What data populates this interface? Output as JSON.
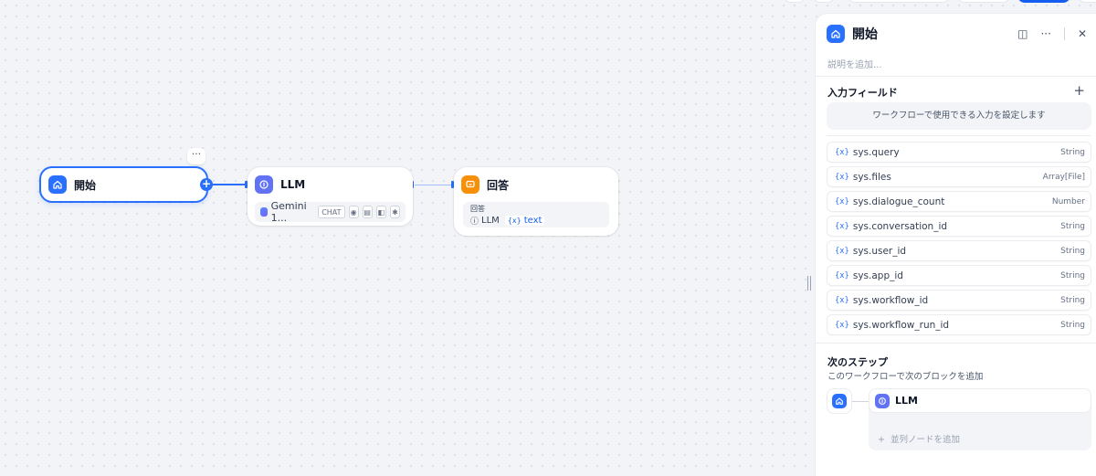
{
  "canvas": {
    "start_node": {
      "title": "開始",
      "more": "···"
    },
    "llm_node": {
      "title": "LLM",
      "model": "Gemini 1...",
      "mode_tag": "CHAT"
    },
    "answer_node": {
      "title": "回答",
      "label": "回答",
      "var_node": "LLM",
      "var_name": "text"
    }
  },
  "panel": {
    "title": "開始",
    "description_placeholder": "説明を追加...",
    "input_section_title": "入力フィールド",
    "input_hint": "ワークフローで使用できる入力を設定します",
    "variables": [
      {
        "name": "sys.query",
        "type": "String"
      },
      {
        "name": "sys.files",
        "type": "Array[File]"
      },
      {
        "name": "sys.dialogue_count",
        "type": "Number"
      },
      {
        "name": "sys.conversation_id",
        "type": "String"
      },
      {
        "name": "sys.user_id",
        "type": "String"
      },
      {
        "name": "sys.app_id",
        "type": "String"
      },
      {
        "name": "sys.workflow_id",
        "type": "String"
      },
      {
        "name": "sys.workflow_run_id",
        "type": "String"
      }
    ],
    "next_step_title": "次のステップ",
    "next_step_desc": "このワークフローで次のブロックを追加",
    "next_node_label": "LLM",
    "add_parallel": "並列ノードを追加"
  },
  "colors": {
    "accent": "#2970ff",
    "llm": "#6172f3",
    "answer": "#f79009"
  }
}
